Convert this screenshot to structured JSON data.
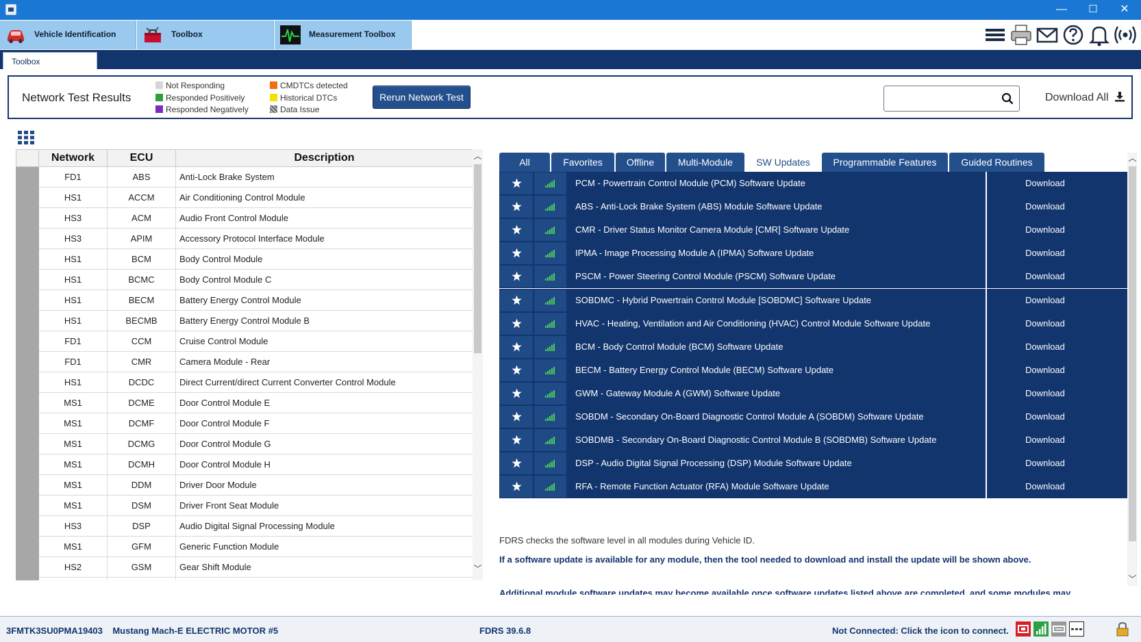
{
  "window": {
    "minimize_glyph": "—",
    "maximize_glyph": "☐",
    "close_glyph": "✕"
  },
  "nav": {
    "tabs": [
      {
        "label": "Vehicle Identification",
        "icon": "car-icon"
      },
      {
        "label": "Toolbox",
        "icon": "toolbox-icon"
      },
      {
        "label": "Measurement Toolbox",
        "icon": "oscilloscope-icon"
      }
    ],
    "actions": [
      "menu-icon",
      "printer-icon",
      "mail-icon",
      "help-icon",
      "bell-icon",
      "wireless-icon"
    ]
  },
  "subtab": {
    "label": "Toolbox"
  },
  "network_test": {
    "title": "Network Test Results",
    "legend": [
      {
        "label": "Not Responding",
        "color": "#d6d6d6"
      },
      {
        "label": "Responded Positively",
        "color": "#2e9e3e"
      },
      {
        "label": "Responded Negatively",
        "color": "#7b2cbf"
      },
      {
        "label": "CMDTCs detected",
        "color": "#f26d13"
      },
      {
        "label": "Historical DTCs",
        "color": "#f5e000"
      },
      {
        "label": "Data Issue",
        "color": "#8a8a8a"
      }
    ],
    "rerun_label": "Rerun Network Test",
    "search_placeholder": "",
    "download_all_label": "Download All"
  },
  "ecu_table": {
    "headers": [
      "Network",
      "ECU",
      "Description"
    ],
    "rows": [
      {
        "network": "FD1",
        "ecu": "ABS",
        "description": "Anti-Lock Brake System"
      },
      {
        "network": "HS1",
        "ecu": "ACCM",
        "description": "Air Conditioning Control Module"
      },
      {
        "network": "HS3",
        "ecu": "ACM",
        "description": "Audio Front Control Module"
      },
      {
        "network": "HS3",
        "ecu": "APIM",
        "description": "Accessory Protocol Interface Module"
      },
      {
        "network": "HS1",
        "ecu": "BCM",
        "description": "Body Control Module"
      },
      {
        "network": "HS1",
        "ecu": "BCMC",
        "description": "Body Control Module C"
      },
      {
        "network": "HS1",
        "ecu": "BECM",
        "description": "Battery Energy Control Module"
      },
      {
        "network": "HS1",
        "ecu": "BECMB",
        "description": "Battery Energy Control Module B"
      },
      {
        "network": "FD1",
        "ecu": "CCM",
        "description": "Cruise Control Module"
      },
      {
        "network": "FD1",
        "ecu": "CMR",
        "description": "Camera Module - Rear"
      },
      {
        "network": "HS1",
        "ecu": "DCDC",
        "description": "Direct Current/direct Current Converter Control Module"
      },
      {
        "network": "MS1",
        "ecu": "DCME",
        "description": "Door Control Module E"
      },
      {
        "network": "MS1",
        "ecu": "DCMF",
        "description": "Door Control Module F"
      },
      {
        "network": "MS1",
        "ecu": "DCMG",
        "description": "Door Control Module G"
      },
      {
        "network": "MS1",
        "ecu": "DCMH",
        "description": "Door Control Module H"
      },
      {
        "network": "MS1",
        "ecu": "DDM",
        "description": "Driver Door Module"
      },
      {
        "network": "MS1",
        "ecu": "DSM",
        "description": "Driver Front Seat Module"
      },
      {
        "network": "HS3",
        "ecu": "DSP",
        "description": "Audio Digital Signal Processing Module"
      },
      {
        "network": "MS1",
        "ecu": "GFM",
        "description": "Generic Function Module"
      },
      {
        "network": "HS2",
        "ecu": "GSM",
        "description": "Gear Shift Module"
      },
      {
        "network": "",
        "ecu": "",
        "description": ""
      }
    ]
  },
  "right_tabs": [
    {
      "label": "All",
      "active": false
    },
    {
      "label": "Favorites",
      "active": false
    },
    {
      "label": "Offline",
      "active": false
    },
    {
      "label": "Multi-Module",
      "active": false
    },
    {
      "label": "SW Updates",
      "active": true
    },
    {
      "label": "Programmable Features",
      "active": false
    },
    {
      "label": "Guided Routines",
      "active": false
    }
  ],
  "sw_updates": {
    "download_label": "Download",
    "items": [
      "PCM - Powertrain Control Module (PCM) Software Update",
      "ABS - Anti-Lock Brake System (ABS) Module Software Update",
      "CMR - Driver Status Monitor Camera Module [CMR] Software Update",
      "IPMA - Image Processing Module A (IPMA) Software Update",
      "PSCM - Power Steering Control Module (PSCM) Software Update",
      "SOBDMC - Hybrid Powertrain Control Module [SOBDMC] Software Update",
      "HVAC - Heating, Ventilation and Air Conditioning (HVAC) Control Module Software Update",
      "BCM - Body Control Module (BCM) Software Update",
      "BECM - Battery Energy Control Module (BECM) Software Update",
      "GWM - Gateway Module A (GWM) Software Update",
      "SOBDM - Secondary On-Board Diagnostic Control Module A (SOBDM) Software Update",
      "SOBDMB - Secondary On-Board Diagnostic Control Module B (SOBDMB) Software Update",
      "DSP - Audio Digital Signal Processing (DSP) Module Software Update",
      "RFA - Remote Function Actuator (RFA) Module Software Update"
    ]
  },
  "info": {
    "line1": "FDRS checks the software level in all modules during Vehicle ID.",
    "line2": "If a software update is available for any module, then the tool needed to download and install the update will be shown above.",
    "line3": "Additional module software updates may become available once software updates listed above are completed, and some modules may"
  },
  "statusbar": {
    "vin": "3FMTK3SU0PMA19403",
    "vehicle": "Mustang Mach-E ELECTRIC MOTOR #5",
    "version": "FDRS 39.6.8",
    "connection": "Not Connected: Click the icon to connect.",
    "icons": [
      "vci-red-icon",
      "signal-icon",
      "cable-icon",
      "dashes-icon",
      "lock-icon"
    ]
  },
  "colors": {
    "titlebar": "#1a78d4",
    "nav_tab": "#99c9ee",
    "navy": "#12356d",
    "row_button": "#1f4a85",
    "signal_green": "#4dd05a"
  }
}
